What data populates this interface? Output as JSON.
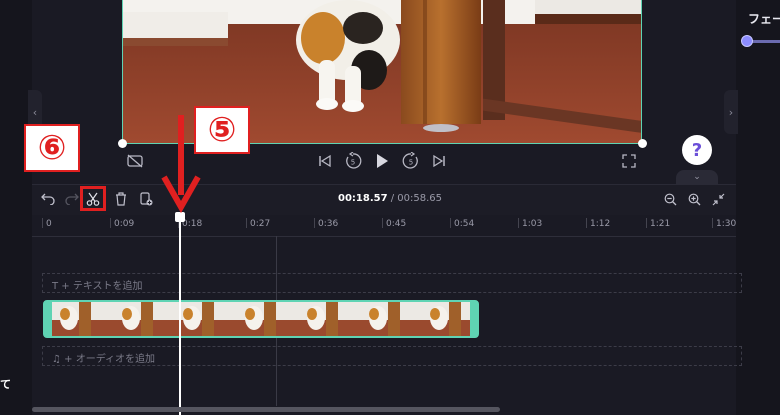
{
  "right_panel": {
    "title": "フェー",
    "collapse_icon": "chevron-right-icon"
  },
  "left_panel": {
    "label": "て",
    "collapse_icon": "chevron-left-icon"
  },
  "player": {
    "controls": [
      "captions-off-icon",
      "skip-back-icon",
      "rewind-5-icon",
      "play-icon",
      "forward-5-icon",
      "skip-forward-icon",
      "fullscreen-icon"
    ],
    "rewind_label": "5",
    "forward_label": "5",
    "help_label": "?"
  },
  "toolbar": {
    "tools": [
      "undo-icon",
      "redo-icon",
      "scissors-icon",
      "trash-icon",
      "duplicate-icon"
    ],
    "time_current": "00:18.57",
    "time_separator": " / ",
    "time_total": "00:58.65",
    "zoom_tools": [
      "zoom-out-icon",
      "zoom-in-icon",
      "fit-icon"
    ]
  },
  "ruler": {
    "labels": [
      "0",
      "0:09",
      "0:18",
      "0:27",
      "0:36",
      "0:45",
      "0:54",
      "1:03",
      "1:12",
      "1:21",
      "1:30"
    ]
  },
  "tracks": {
    "text_track_label": "T  + テキストを追加",
    "audio_track_label": "♫  + オーディオを追加",
    "video_clip_thumbnails": 7
  },
  "annotations": {
    "step5": "⑤",
    "step6": "⑥",
    "arrow": "down-arrow"
  },
  "colors": {
    "accent": "#5fd3b3",
    "annotation_red": "#e02020",
    "help_purple": "#6b4fd8",
    "background": "#1a1a24"
  }
}
